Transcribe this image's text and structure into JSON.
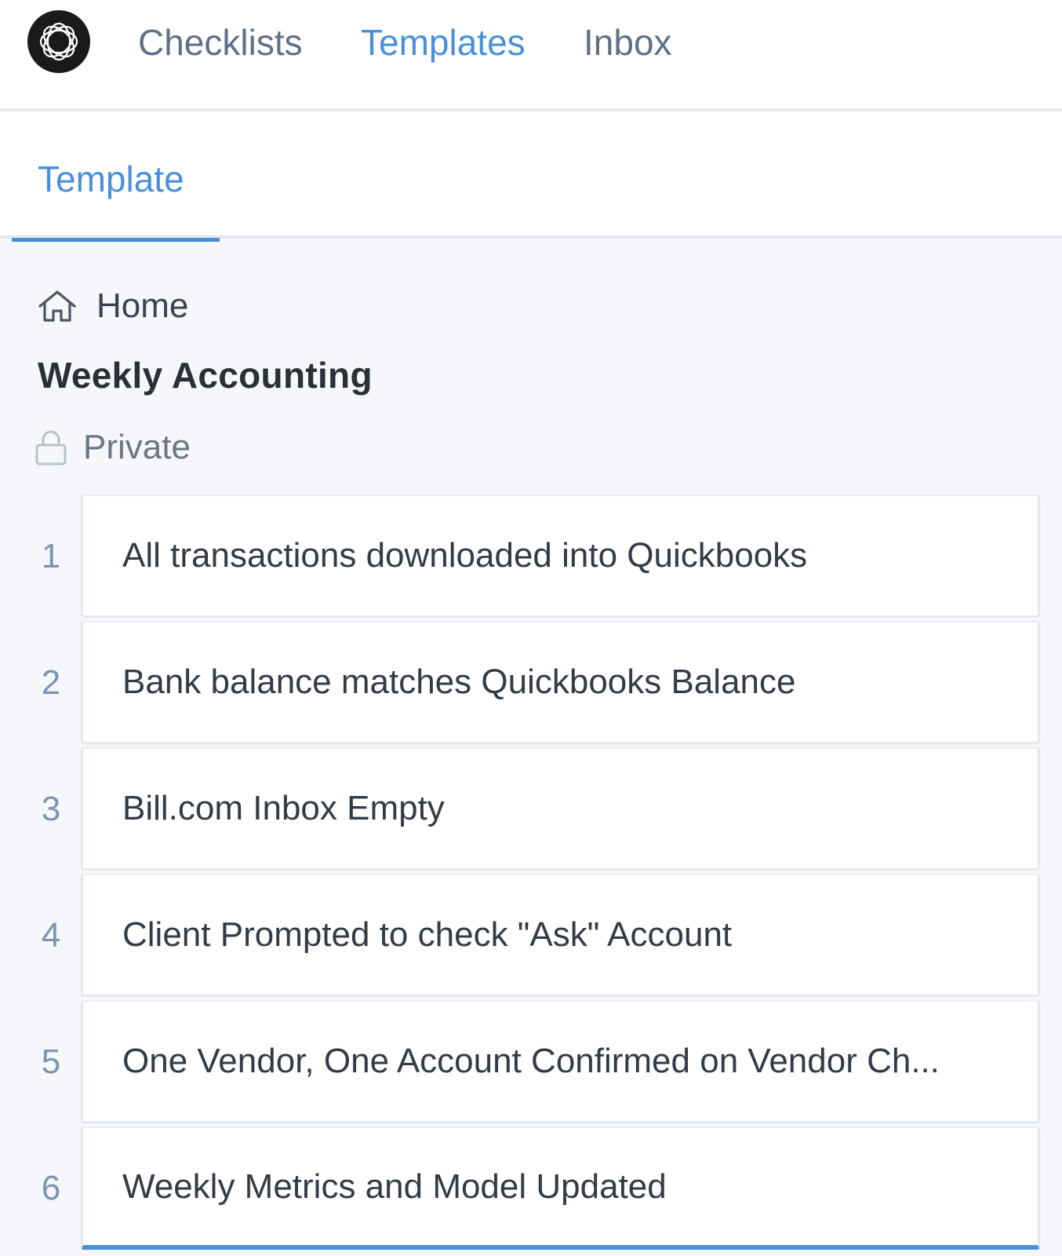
{
  "nav": {
    "logo_icon": "app-logo-icon",
    "links": [
      {
        "label": "Checklists",
        "active": false
      },
      {
        "label": "Templates",
        "active": true
      },
      {
        "label": "Inbox",
        "active": false
      }
    ]
  },
  "tabs": {
    "active_label": "Template"
  },
  "breadcrumb": {
    "icon": "home-icon",
    "label": "Home"
  },
  "template": {
    "title": "Weekly Accounting",
    "privacy_icon": "lock-icon",
    "privacy_label": "Private"
  },
  "tasks": [
    {
      "number": "1",
      "text": "All transactions downloaded into Quickbooks"
    },
    {
      "number": "2",
      "text": "Bank balance matches Quickbooks Balance"
    },
    {
      "number": "3",
      "text": "Bill.com Inbox Empty"
    },
    {
      "number": "4",
      "text": "Client Prompted to check \"Ask\" Account"
    },
    {
      "number": "5",
      "text": "One Vendor, One Account Confirmed on Vendor Ch..."
    },
    {
      "number": "6",
      "text": "Weekly Metrics and Model Updated"
    }
  ],
  "colors": {
    "accent": "#4a90d9",
    "nav_text": "#5f7187",
    "background": "#f5f7fa"
  }
}
